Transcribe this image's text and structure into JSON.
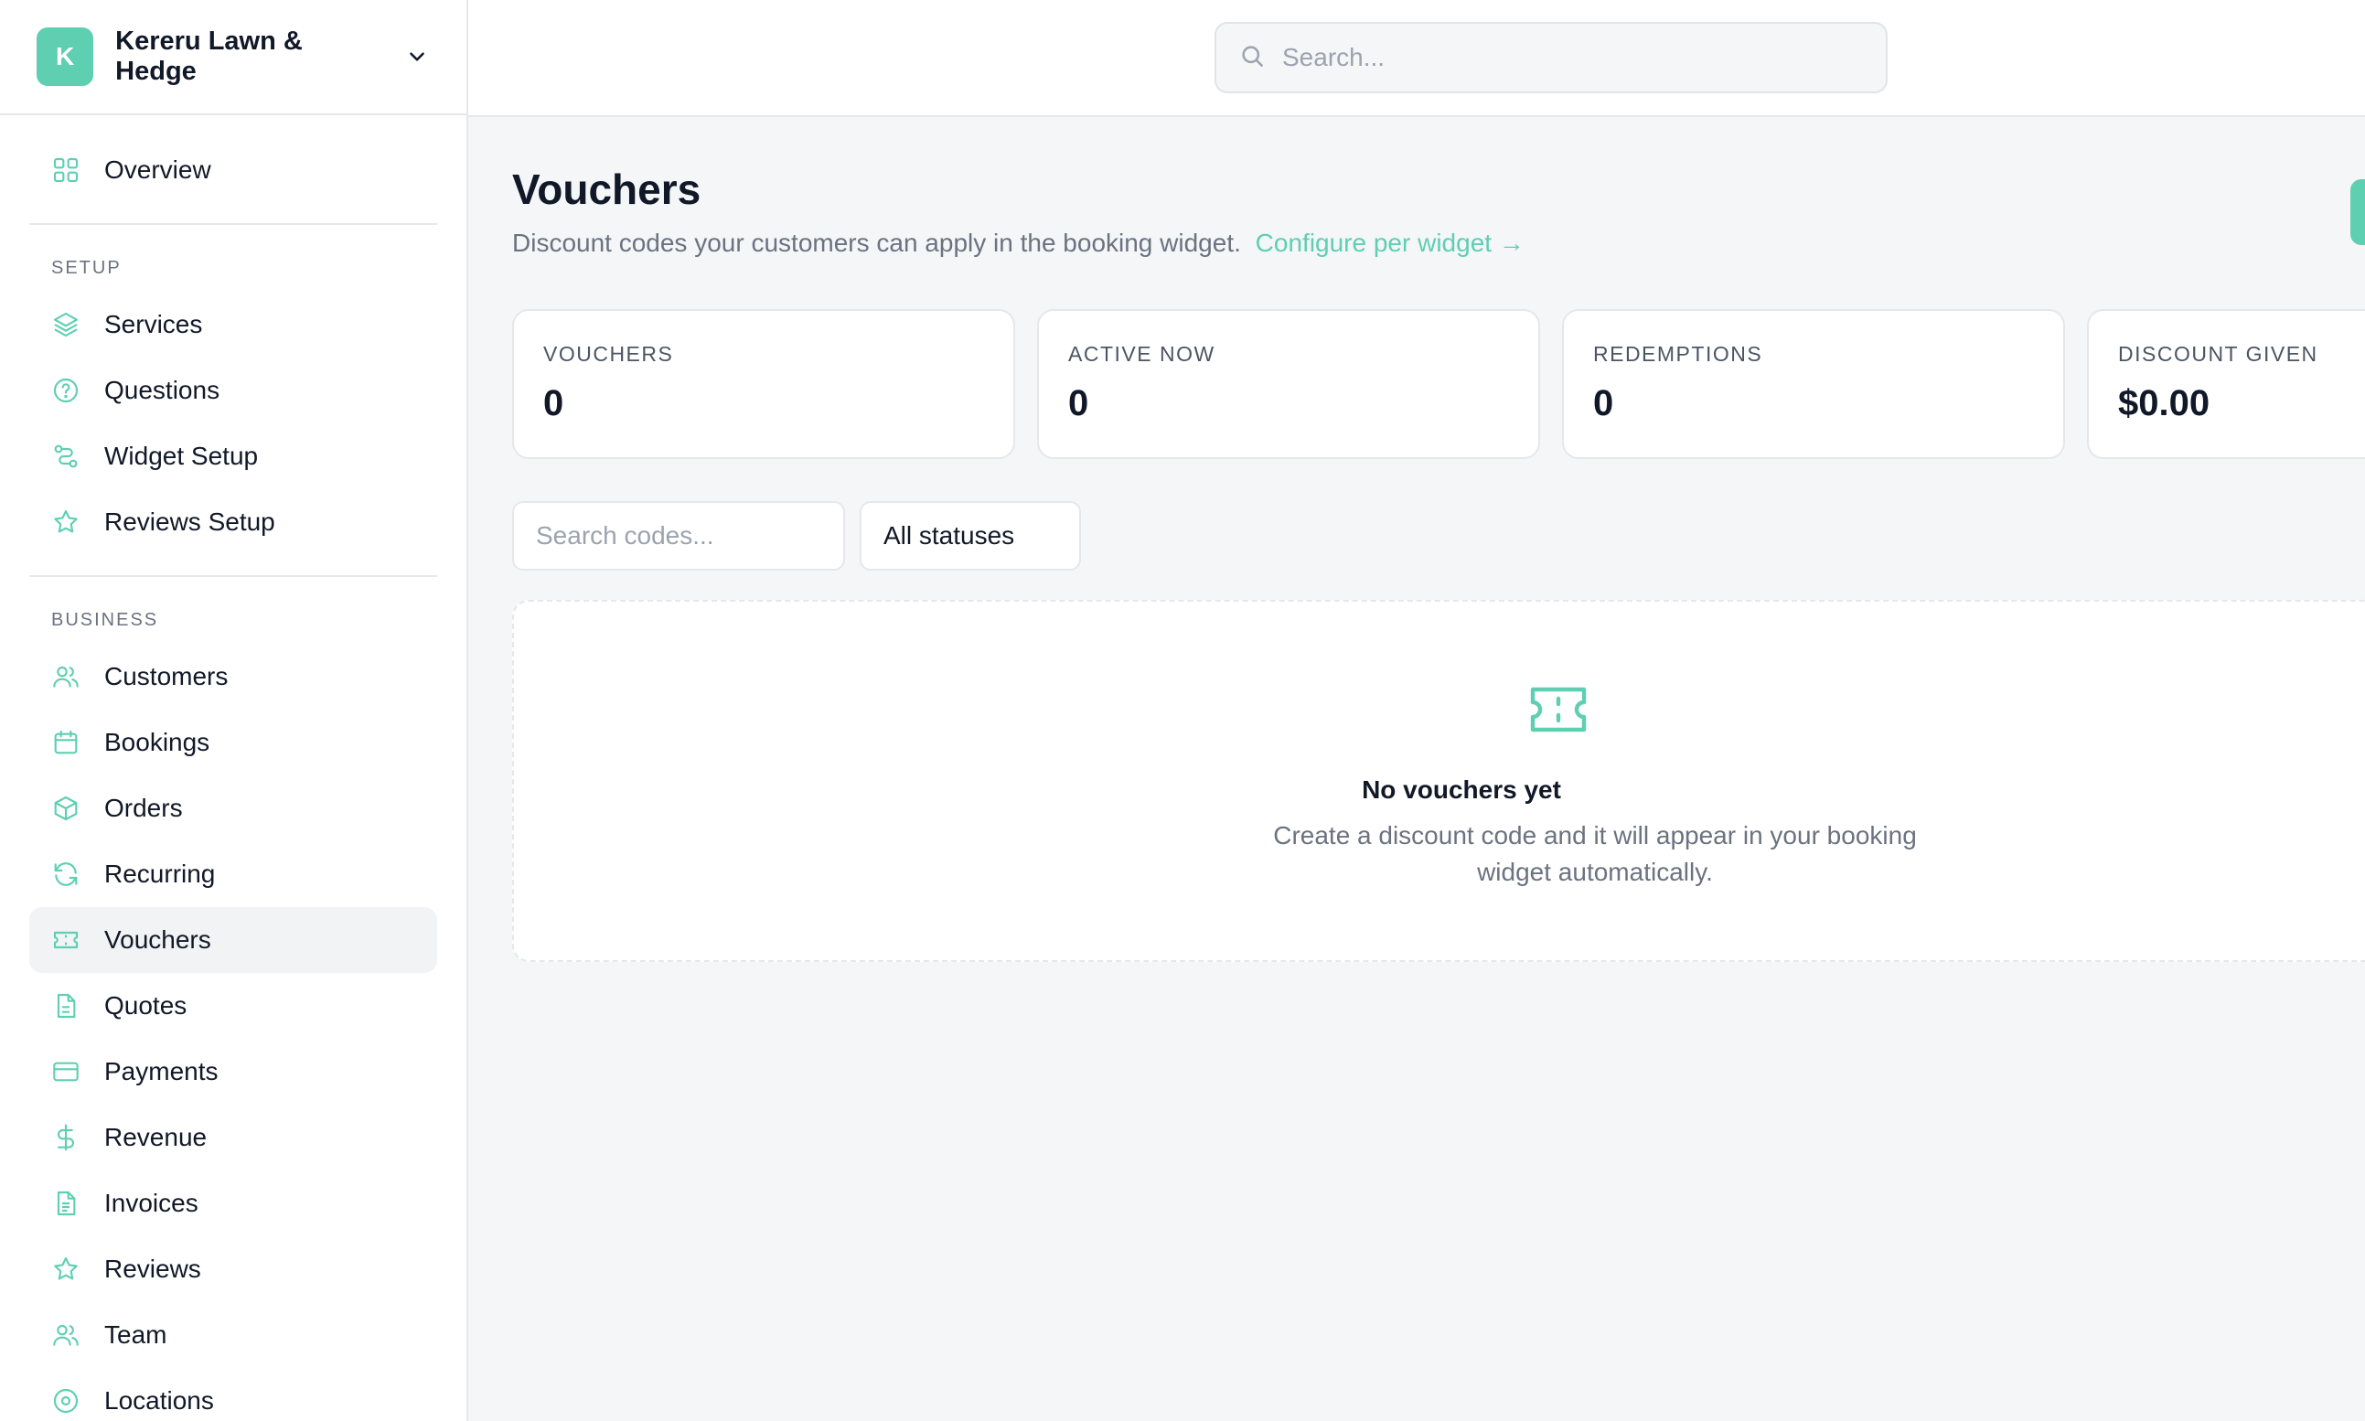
{
  "brand": {
    "initial": "K",
    "name": "Kereru Lawn & Hedge"
  },
  "header": {
    "search_placeholder": "Search..."
  },
  "sidebar": {
    "top_items": [
      {
        "label": "Overview",
        "icon": "grid-icon"
      }
    ],
    "setup": {
      "title": "SETUP",
      "items": [
        {
          "label": "Services",
          "icon": "layers-icon"
        },
        {
          "label": "Questions",
          "icon": "question-circle-icon"
        },
        {
          "label": "Widget Setup",
          "icon": "route-icon"
        },
        {
          "label": "Reviews Setup",
          "icon": "star-icon"
        }
      ]
    },
    "business": {
      "title": "BUSINESS",
      "items": [
        {
          "label": "Customers",
          "icon": "users-icon"
        },
        {
          "label": "Bookings",
          "icon": "calendar-icon"
        },
        {
          "label": "Orders",
          "icon": "box-icon"
        },
        {
          "label": "Recurring",
          "icon": "refresh-icon"
        },
        {
          "label": "Vouchers",
          "icon": "ticket-icon",
          "active": true
        },
        {
          "label": "Quotes",
          "icon": "file-icon"
        },
        {
          "label": "Payments",
          "icon": "credit-card-icon"
        },
        {
          "label": "Revenue",
          "icon": "dollar-icon"
        },
        {
          "label": "Invoices",
          "icon": "file-text-icon"
        },
        {
          "label": "Reviews",
          "icon": "star-icon"
        },
        {
          "label": "Team",
          "icon": "users-icon"
        },
        {
          "label": "Locations",
          "icon": "map-pin-icon"
        }
      ]
    }
  },
  "page": {
    "title": "Vouchers",
    "subtitle": "Discount codes your customers can apply in the booking widget.",
    "subtitle_link": "Configure per widget →"
  },
  "stats": [
    {
      "label": "VOUCHERS",
      "value": "0"
    },
    {
      "label": "ACTIVE NOW",
      "value": "0"
    },
    {
      "label": "REDEMPTIONS",
      "value": "0"
    },
    {
      "label": "DISCOUNT GIVEN",
      "value": "$0.00"
    }
  ],
  "filters": {
    "search_placeholder": "Search codes...",
    "status_value": "All statuses"
  },
  "empty": {
    "title": "No vouchers yet",
    "description": "Create a discount code and it will appear in your booking widget automatically."
  },
  "colors": {
    "accent": "#5ecfb1",
    "text": "#111827",
    "muted": "#6b7280",
    "border": "#e5e7eb"
  }
}
